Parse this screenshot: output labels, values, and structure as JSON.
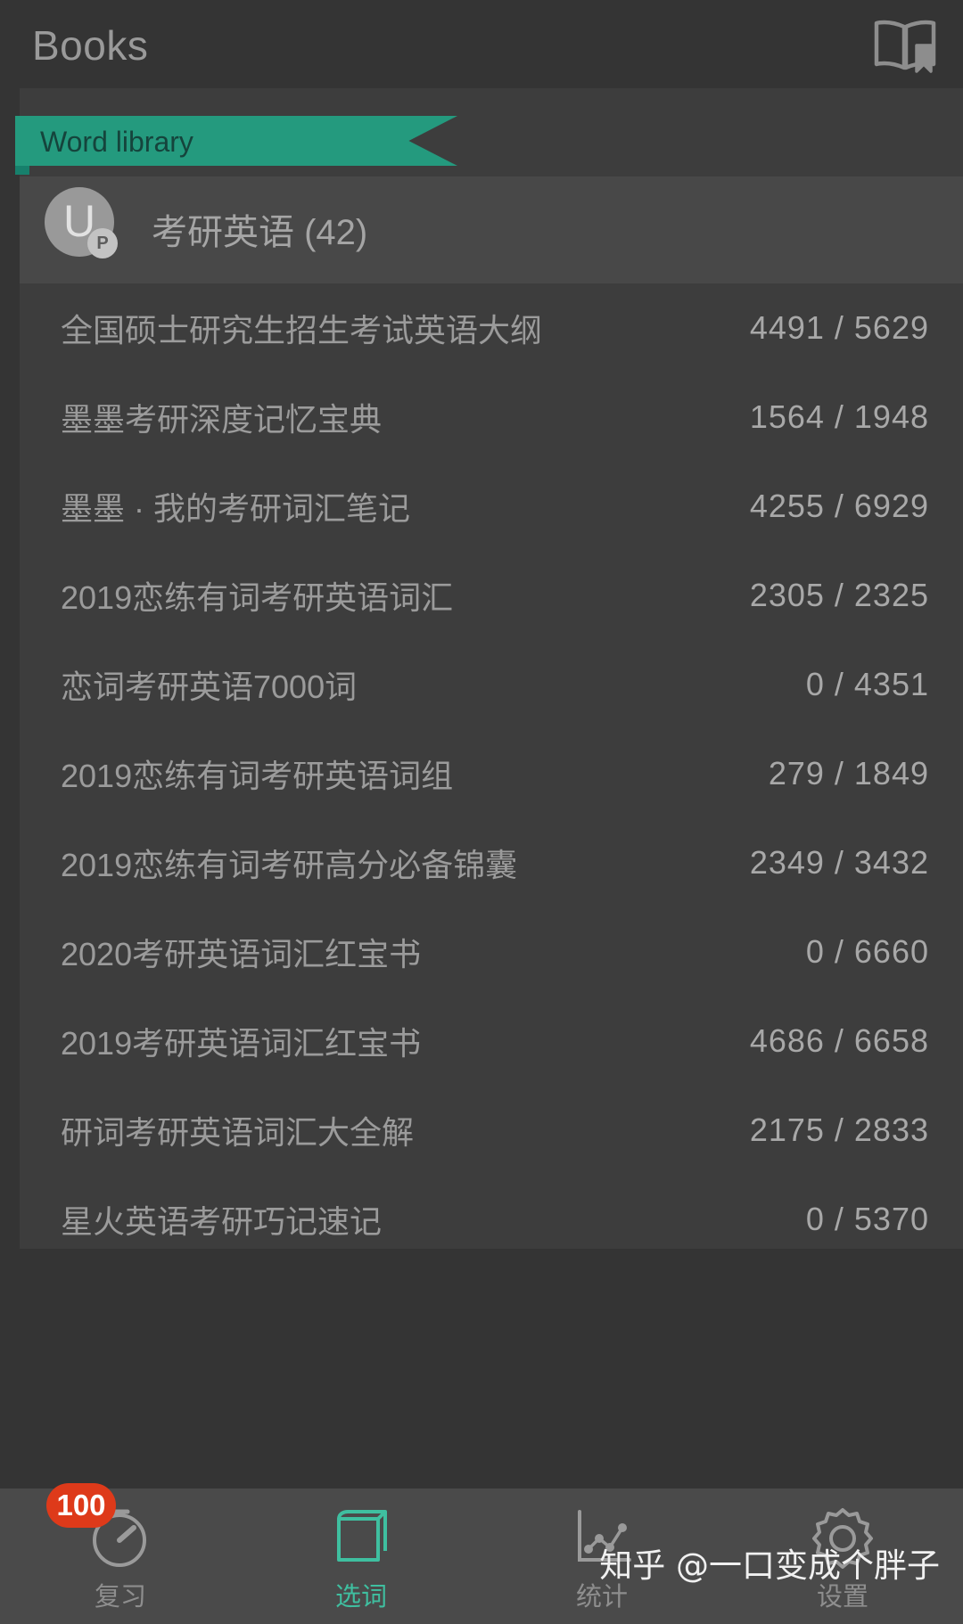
{
  "header": {
    "title": "Books",
    "icon": "open-book-bookmark-icon"
  },
  "ribbon": {
    "label": "Word library",
    "color": "#249a7e",
    "text_color": "#15443c"
  },
  "group": {
    "avatar_letter": "U",
    "avatar_badge": "P",
    "title": "考研英语 (42)"
  },
  "books": [
    {
      "name": "全国硕士研究生招生考试英语大纲",
      "count": "4491 / 5629"
    },
    {
      "name": "墨墨考研深度记忆宝典",
      "count": "1564 / 1948"
    },
    {
      "name": "墨墨 · 我的考研词汇笔记",
      "count": "4255 / 6929"
    },
    {
      "name": "2019恋练有词考研英语词汇",
      "count": "2305 / 2325"
    },
    {
      "name": "恋词考研英语7000词",
      "count": "0 / 4351"
    },
    {
      "name": "2019恋练有词考研英语词组",
      "count": "279 / 1849"
    },
    {
      "name": "2019恋练有词考研高分必备锦囊",
      "count": "2349 / 3432"
    },
    {
      "name": "2020考研英语词汇红宝书",
      "count": "0 / 6660"
    },
    {
      "name": "2019考研英语词汇红宝书",
      "count": "4686 / 6658"
    },
    {
      "name": "研词考研英语词汇大全解",
      "count": "2175 / 2833"
    },
    {
      "name": "星火英语考研巧记速记",
      "count": "0 / 5370"
    }
  ],
  "bottom_nav": {
    "items": [
      {
        "label": "复习",
        "icon": "timer-clock-icon",
        "badge": "100",
        "active": false
      },
      {
        "label": "选词",
        "icon": "book-icon",
        "badge": "",
        "active": true
      },
      {
        "label": "统计",
        "icon": "line-chart-icon",
        "badge": "",
        "active": false
      },
      {
        "label": "设置",
        "icon": "gear-icon",
        "badge": "",
        "active": false
      }
    ],
    "active_color": "#3fbfa0",
    "inactive_color": "#8e8e8e"
  },
  "watermark": {
    "text": "知乎 @一口变成个胖子"
  }
}
